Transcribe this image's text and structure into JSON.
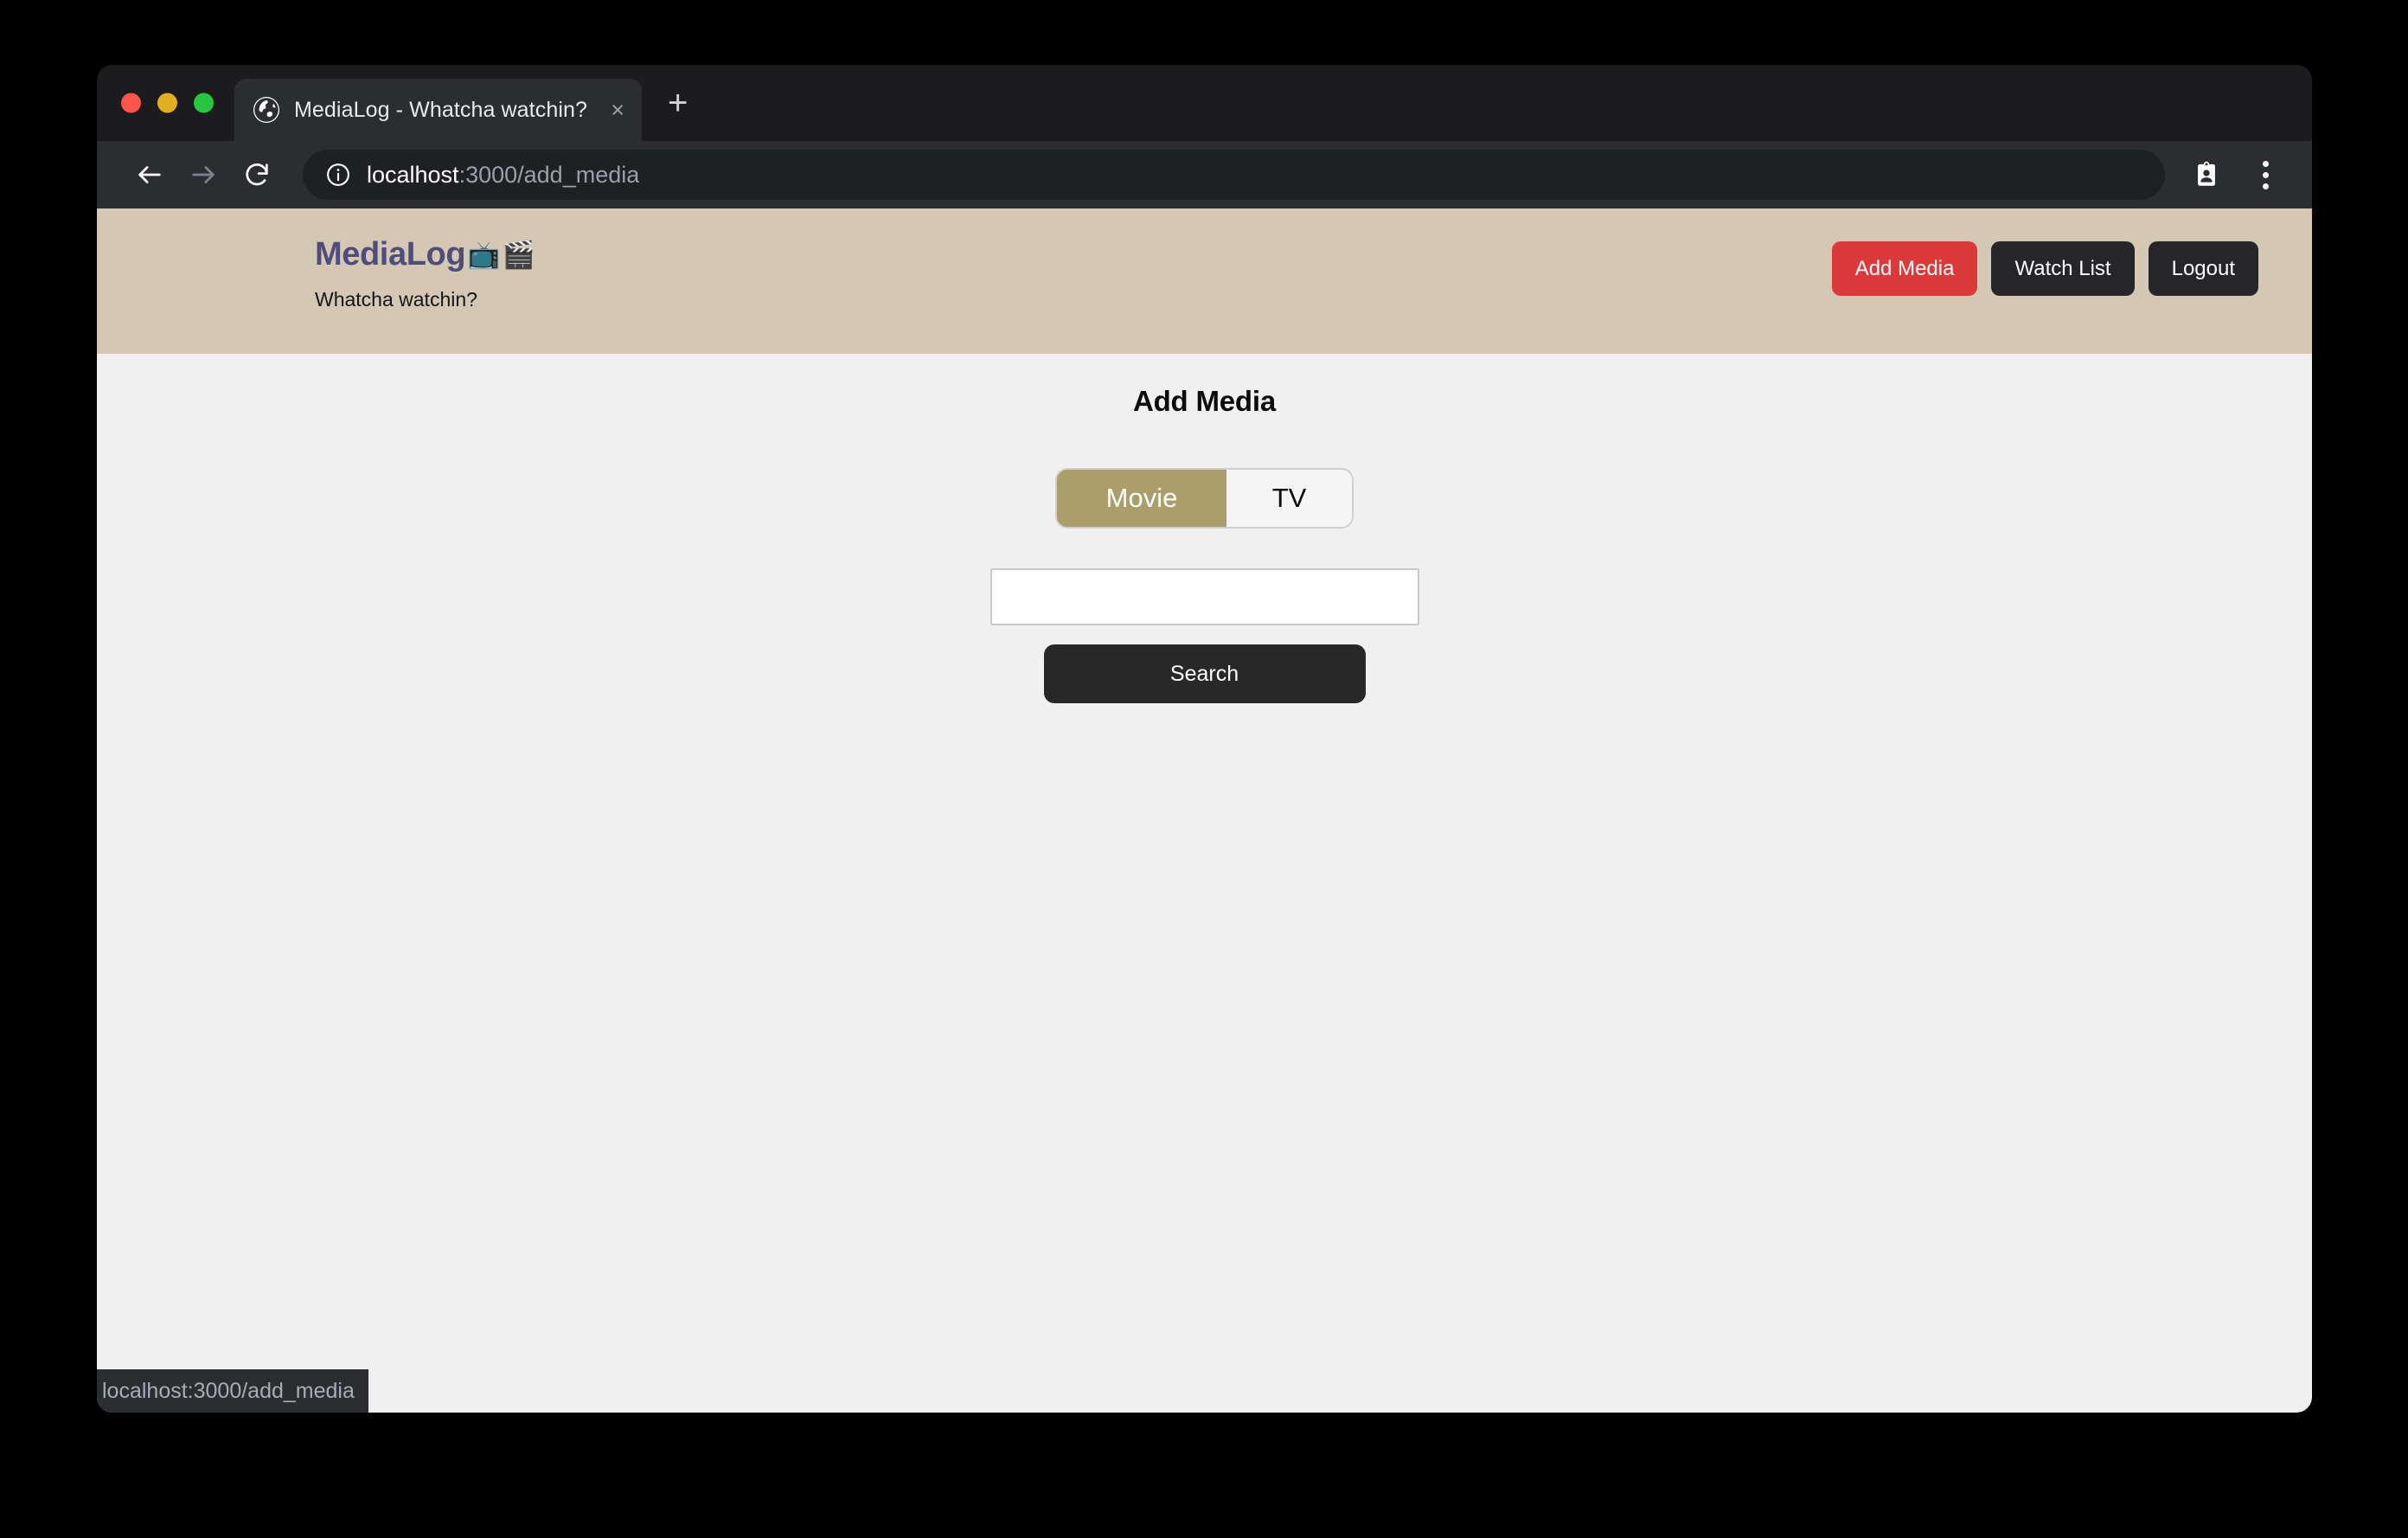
{
  "browser": {
    "tab": {
      "title": "MediaLog - Whatcha watchin?",
      "close_label": "×",
      "favicon_name": "globe-favicon"
    },
    "new_tab_label": "+",
    "nav": {
      "back_label": "Back",
      "forward_label": "Forward",
      "reload_label": "Reload"
    },
    "url": {
      "host": "localhost",
      "path": ":3000/add_media",
      "full": "localhost:3000/add_media"
    },
    "status_bar": {
      "text": "localhost:3000/add_media"
    },
    "traffic_lights": {
      "close_color": "#ff544a",
      "minimize_color": "#e0b01e",
      "maximize_color": "#28c63f"
    }
  },
  "app": {
    "brand": {
      "name": "MediaLog",
      "emoji_tv": "📺",
      "emoji_clapper": "🎬",
      "tagline": "Whatcha watchin?",
      "color": "#4f4e7a"
    },
    "nav": [
      {
        "label": "Add Media",
        "style": "primary"
      },
      {
        "label": "Watch List",
        "style": "dark"
      },
      {
        "label": "Logout",
        "style": "dark"
      }
    ],
    "header_background": "#d4c7b4"
  },
  "main": {
    "title": "Add Media",
    "media_type": {
      "options": [
        {
          "label": "Movie",
          "active": true
        },
        {
          "label": "TV",
          "active": false
        }
      ],
      "selected": "Movie",
      "active_color": "#ab9e6b"
    },
    "search": {
      "value": "",
      "placeholder": "",
      "button_label": "Search"
    }
  }
}
